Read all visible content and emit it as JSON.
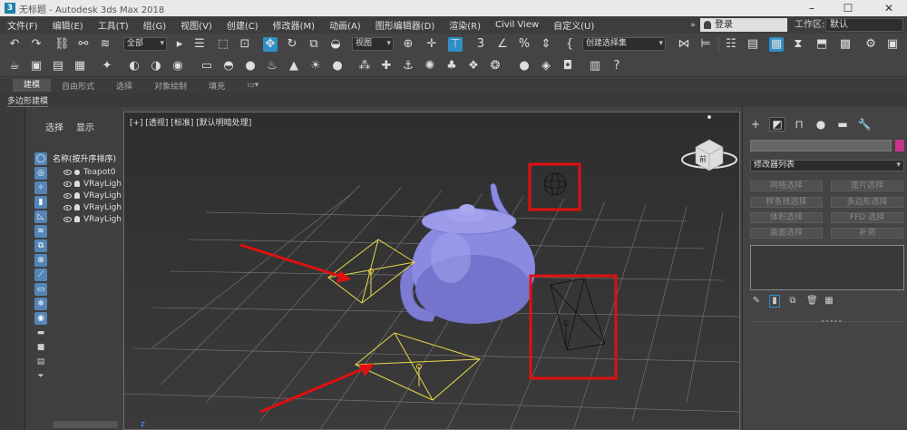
{
  "window": {
    "title": "无标题 - Autodesk 3ds Max 2018",
    "app_icon": "3",
    "controls": [
      "–",
      "☐",
      "✕"
    ]
  },
  "menu": {
    "items": [
      "文件(F)",
      "编辑(E)",
      "工具(T)",
      "组(G)",
      "视图(V)",
      "创建(C)",
      "修改器(M)",
      "动画(A)",
      "图形编辑器(D)",
      "渲染(R)",
      "Civil View",
      "自定义(U)"
    ],
    "login": "登录",
    "workspace_label": "工作区:",
    "workspace_value": "默认"
  },
  "toolbar": {
    "filter_select": "全部",
    "ref_coord_select": "视图",
    "selection_set_select": "创建选择集"
  },
  "ribbon": {
    "tabs": [
      "建模",
      "自由形式",
      "选择",
      "对象绘制",
      "填充"
    ],
    "active_tab": "建模",
    "sub_label": "多边形建模"
  },
  "explorer": {
    "tabs": [
      "选择",
      "显示"
    ],
    "header": "名称(按升序排序)",
    "items": [
      {
        "name": "Teapot0",
        "kind": "geometry"
      },
      {
        "name": "VRayLigh",
        "kind": "light"
      },
      {
        "name": "VRayLigh",
        "kind": "light"
      },
      {
        "name": "VRayLigh",
        "kind": "light"
      },
      {
        "name": "VRayLigh",
        "kind": "light"
      }
    ]
  },
  "viewport": {
    "label": "[+] [透视] [标准] [默认明暗处理]",
    "viewcube_label": "前",
    "axis_label": "z",
    "teapot_color": "#8a8ae0",
    "selected_light_color": "#e8d84a",
    "highlight_color": "#e01010"
  },
  "command_panel": {
    "modifier_list": "修改器列表",
    "object_color": "#c8338a",
    "buttons": [
      [
        "网格选择",
        "面片选择"
      ],
      [
        "样条线选择",
        "多边形选择"
      ],
      [
        "体积选择",
        "FFD 选择"
      ],
      [
        "曲面选择",
        "补洞"
      ]
    ]
  }
}
